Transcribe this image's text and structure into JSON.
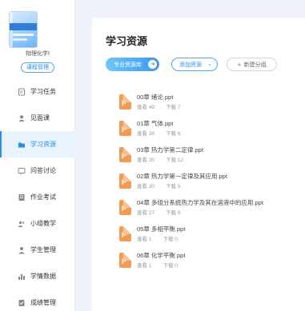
{
  "sidebar": {
    "course_name": "物理化学I",
    "course_mgmt_label": "课程管理",
    "items": [
      {
        "label": "学习任务",
        "icon": "document-icon",
        "active": false
      },
      {
        "label": "见面课",
        "icon": "person-icon",
        "active": false
      },
      {
        "label": "学习资源",
        "icon": "folder-icon",
        "active": true
      },
      {
        "label": "问答讨论",
        "icon": "chat-icon",
        "active": false
      },
      {
        "label": "作业考试",
        "icon": "exam-icon",
        "active": false
      },
      {
        "label": "小组教学",
        "icon": "group-icon",
        "active": false
      },
      {
        "label": "学生管理",
        "icon": "student-icon",
        "active": false
      },
      {
        "label": "学情数据",
        "icon": "bar-chart-icon",
        "active": false
      },
      {
        "label": "成绩管理",
        "icon": "grade-icon",
        "active": false
      }
    ]
  },
  "main": {
    "title": "学习资源",
    "primary_button": "专业资源库",
    "add_button": "添加资源",
    "group_button": "新建分组",
    "files": [
      {
        "name": "00章 绪论.ppt",
        "views_label": "查看",
        "views": "49",
        "downloads_label": "下载",
        "downloads": "7"
      },
      {
        "name": "01章 气体.ppt",
        "views_label": "查看",
        "views": "38",
        "downloads_label": "下载",
        "downloads": "6"
      },
      {
        "name": "03章 热力学第二定律.ppt",
        "views_label": "查看",
        "views": "35",
        "downloads_label": "下载",
        "downloads": "12"
      },
      {
        "name": "02章 热力学第一定律及其应用.ppt",
        "views_label": "查看",
        "views": "30",
        "downloads_label": "下载",
        "downloads": "5"
      },
      {
        "name": "04章 多组分系统热力学及其在溶液中的应用.ppt",
        "views_label": "查看",
        "views": "27",
        "downloads_label": "下载",
        "downloads": "8"
      },
      {
        "name": "05章 多相平衡.ppt",
        "views_label": "查看",
        "views": "1",
        "downloads_label": "下载",
        "downloads": "0"
      },
      {
        "name": "06章 化学平衡.ppt",
        "views_label": "查看",
        "views": "1",
        "downloads_label": "下载",
        "downloads": "0"
      }
    ]
  },
  "colors": {
    "accent": "#2f8be6",
    "ppt": "#f39a53",
    "background": "#eef3fa"
  }
}
